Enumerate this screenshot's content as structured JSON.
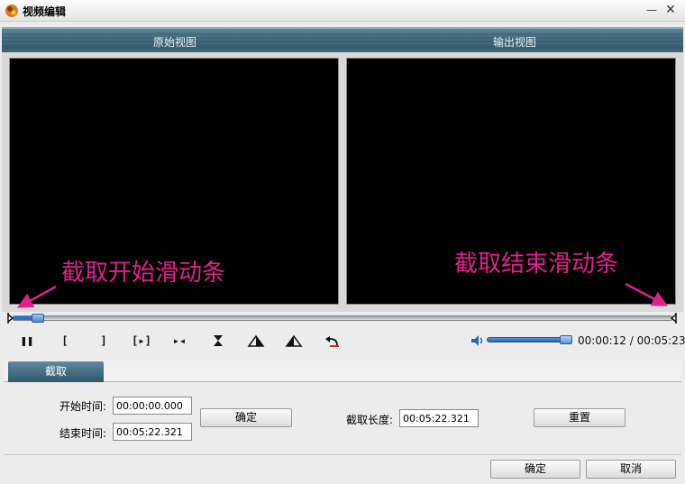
{
  "window": {
    "title": "视频编辑",
    "minimize": "—",
    "close": "✕"
  },
  "views": {
    "source_label": "原始视图",
    "output_label": "输出视图"
  },
  "annotations": {
    "start_slider": "截取开始滑动条",
    "end_slider": "截取结束滑动条",
    "color": "#e0208c"
  },
  "trim": {
    "start_position": 0.04
  },
  "toolbar": {
    "pause": "❚❚",
    "mark_in": "[",
    "mark_out": "]",
    "play_selection": "[▸]",
    "goto_split": "▸◂",
    "icons": [
      "pause-icon",
      "mark-in-icon",
      "mark-out-icon",
      "play-selection-icon",
      "split-icon",
      "center-icon",
      "fade-in-icon",
      "fade-out-icon",
      "undo-icon"
    ]
  },
  "volume": {
    "level": 0.9
  },
  "time": {
    "display": "00:00:12 / 00:05:23"
  },
  "tabs": [
    {
      "label": "截取"
    }
  ],
  "form": {
    "start_label": "开始时间:",
    "start_value": "00:00:00.000",
    "end_label": "结束时间:",
    "end_value": "00:05:22.321",
    "apply_label": "确定",
    "length_label": "截取长度:",
    "length_value": "00:05:22.321",
    "reset_label": "重置"
  },
  "footer": {
    "ok_label": "确定",
    "cancel_label": "取消"
  },
  "colors": {
    "accent": "#2b6fd6",
    "header": "#3c6173"
  }
}
